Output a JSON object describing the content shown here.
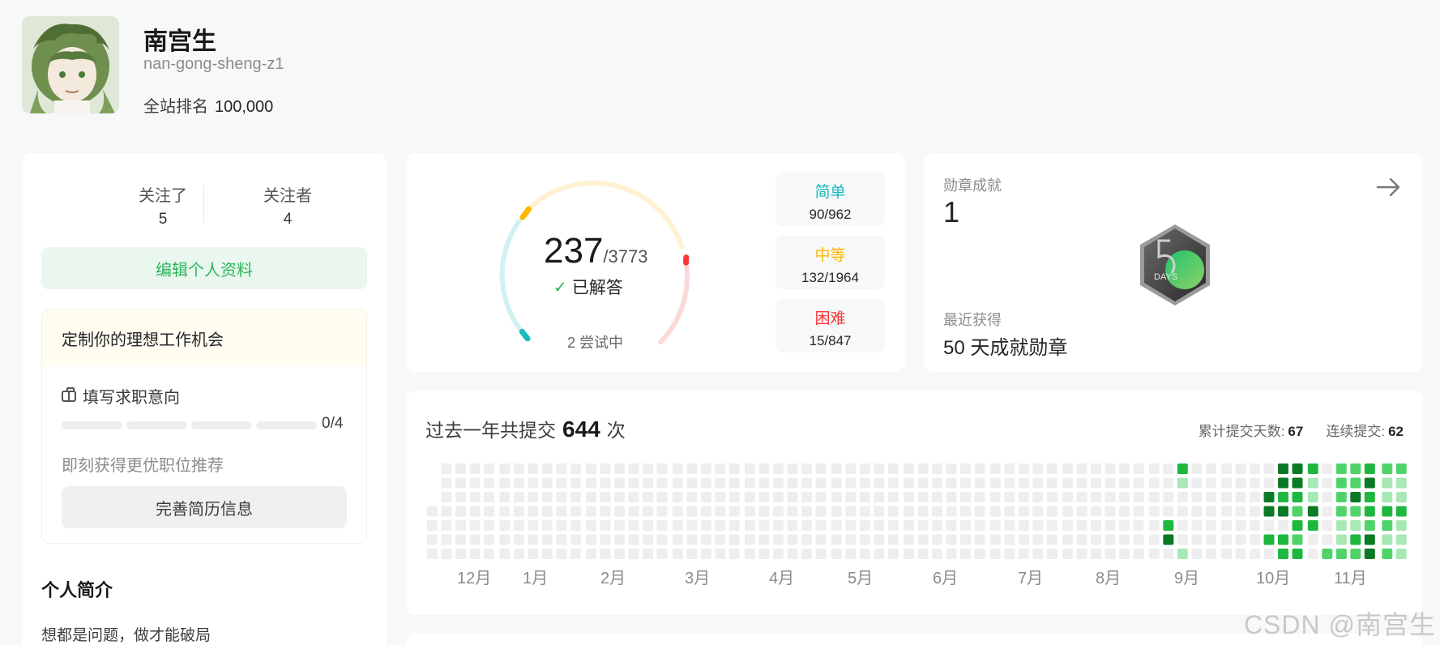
{
  "profile": {
    "name": "南宫生",
    "handle": "nan-gong-sheng-z1",
    "rank_label": "全站排名",
    "rank_value": "100,000"
  },
  "social": {
    "following_label": "关注了",
    "following_count": "5",
    "followers_label": "关注者",
    "followers_count": "4",
    "edit_profile_label": "编辑个人资料"
  },
  "job": {
    "heading": "定制你的理想工作机会",
    "intent_label": "填写求职意向",
    "progress_text": "0/4",
    "progress_fraction": 0,
    "hint": "即刻获得更优职位推荐",
    "resume_button_label": "完善简历信息"
  },
  "intro": {
    "title": "个人简介",
    "text": "想都是问题，做才能破局"
  },
  "problems": {
    "solved": "237",
    "total": "/3773",
    "solved_label": "已解答",
    "attempting_label": "2 尝试中",
    "easy_label": "简单",
    "easy_value": "90/962",
    "medium_label": "中等",
    "medium_value": "132/1964",
    "hard_label": "困难",
    "hard_value": "15/847",
    "colors": {
      "easy": "#1cbaba",
      "medium": "#ffb700",
      "hard": "#f63737"
    }
  },
  "badges": {
    "title": "勋章成就",
    "count": "1",
    "badge_text": "DAYS",
    "recent_label": "最近获得",
    "recent_name": "50 天成就勋章"
  },
  "activity": {
    "title_prefix": "过去一年共提交",
    "count": "644",
    "title_suffix": "次",
    "total_days_label": "累计提交天数:",
    "total_days_value": "67",
    "streak_label": "连续提交:",
    "streak_value": "62",
    "months": [
      "12月",
      "1月",
      "2月",
      "3月",
      "4月",
      "5月",
      "6月",
      "7月",
      "8月",
      "9月",
      "10月",
      "11月"
    ],
    "colors": {
      "empty": "#eeeeee",
      "l1": "#a7e8b4",
      "l2": "#50d46a",
      "l3": "#1eb83f",
      "l4": "#0a7a25"
    }
  },
  "watermark": "CSDN @南宫生"
}
